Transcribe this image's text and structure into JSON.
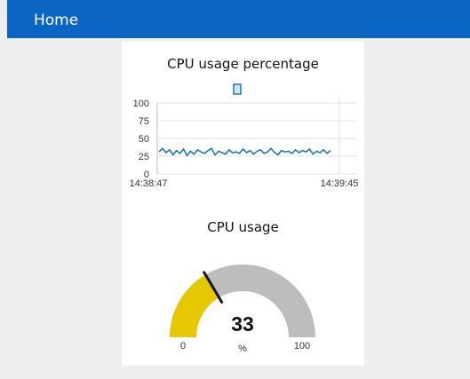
{
  "header": {
    "title": "Home",
    "color": "#0a66c2"
  },
  "widgets": {
    "line_chart_title": "CPU usage percentage",
    "gauge_title": "CPU usage"
  },
  "chart_data": [
    {
      "type": "line",
      "title": "CPU usage percentage",
      "ylim": [
        0,
        100
      ],
      "y_ticks": [
        "100",
        "75",
        "50",
        "25",
        "0"
      ],
      "x_ticks": [
        "14:38:47",
        "14:39:45"
      ],
      "grid": true,
      "legend": "top-center",
      "series": [
        {
          "color": "#1f77b4",
          "values": [
            31,
            36,
            30,
            34,
            27,
            33,
            29,
            35,
            26,
            32,
            28,
            34,
            31,
            29,
            33,
            36,
            27,
            32,
            30,
            28,
            34,
            30,
            31,
            29,
            35,
            30,
            33,
            28,
            32,
            34,
            29,
            31,
            36,
            30,
            27,
            33,
            31,
            32,
            29,
            34,
            30,
            33,
            31,
            35,
            28,
            32,
            30,
            34,
            29,
            33
          ]
        }
      ]
    },
    {
      "type": "gauge",
      "title": "CPU usage",
      "value": 33,
      "value_label": "33",
      "unit": "%",
      "min": 0,
      "max": 100,
      "min_label": "0",
      "max_label": "100",
      "fill_color": "#e6c800",
      "track_color": "#bdbdbd"
    }
  ]
}
